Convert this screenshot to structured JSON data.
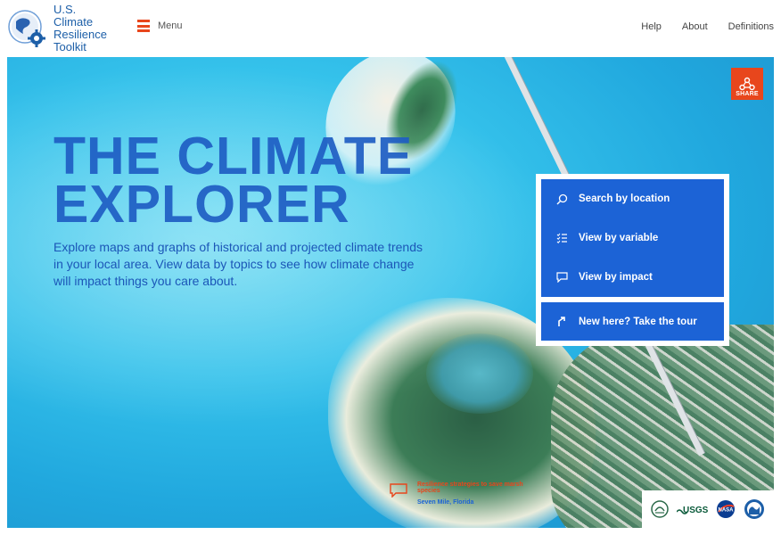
{
  "header": {
    "logo_lines": [
      "U.S. Climate",
      "Resilience",
      "Toolkit"
    ],
    "menu_label": "Menu",
    "links": [
      "Help",
      "About",
      "Definitions"
    ]
  },
  "hero": {
    "share_label": "SHARE",
    "title_lines": [
      "THE CLIMATE",
      "EXPLORER"
    ],
    "description": "Explore maps and graphs of historical and projected climate trends in your local area. View data by topics to see how climate change will impact things you care about.",
    "actions": [
      {
        "label": "Search by location",
        "icon": "search-icon"
      },
      {
        "label": "View by variable",
        "icon": "list-icon"
      },
      {
        "label": "View by impact",
        "icon": "comment-icon"
      }
    ],
    "tour": {
      "label": "New here? Take the tour",
      "icon": "arrow-icon"
    },
    "caption": {
      "title": "Resilience strategies to save marsh species",
      "location": "Seven Mile, Florida"
    },
    "partner_logos": [
      {
        "name": "epa-logo",
        "text": ""
      },
      {
        "name": "usgs-logo",
        "text": "USGS"
      },
      {
        "name": "nasa-logo",
        "text": "NASA"
      },
      {
        "name": "noaa-logo",
        "text": ""
      }
    ]
  },
  "colors": {
    "brand_blue": "#1c63d6",
    "accent_orange": "#e8461c",
    "title_blue": "#1f5ec4"
  }
}
